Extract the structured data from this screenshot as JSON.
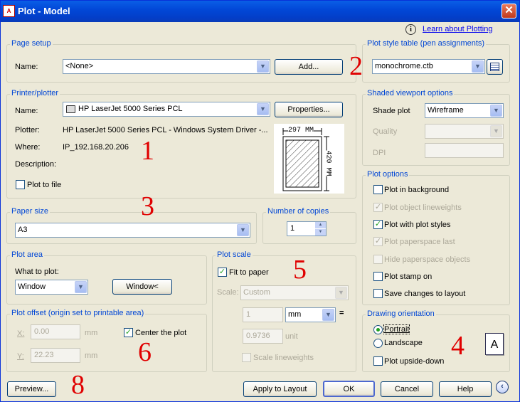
{
  "window": {
    "title": "Plot - Model",
    "close": "✕"
  },
  "help": {
    "icon": "i",
    "link": "Learn about Plotting"
  },
  "page_setup": {
    "title": "Page setup",
    "name_label": "Name:",
    "name_value": "<None>",
    "add_button": "Add..."
  },
  "printer": {
    "title": "Printer/plotter",
    "name_label": "Name:",
    "name_value": "HP LaserJet 5000 Series PCL",
    "properties_button": "Properties...",
    "plotter_label": "Plotter:",
    "plotter_value": "HP LaserJet 5000 Series PCL - Windows System Driver -...",
    "where_label": "Where:",
    "where_value": "IP_192.168.20.206",
    "description_label": "Description:",
    "plot_to_file": "Plot to file",
    "plot_to_file_checked": false,
    "preview_width": "297 MM",
    "preview_height": "420 MM"
  },
  "paper_size": {
    "title": "Paper size",
    "value": "A3"
  },
  "copies": {
    "title": "Number of copies",
    "value": "1"
  },
  "plot_area": {
    "title": "Plot area",
    "what_label": "What to plot:",
    "what_value": "Window",
    "window_button": "Window<"
  },
  "plot_offset": {
    "title": "Plot offset (origin set to printable area)",
    "x_label": "X:",
    "x_value": "0.00",
    "x_unit": "mm",
    "y_label": "Y:",
    "y_value": "22.23",
    "y_unit": "mm",
    "center_label": "Center the plot",
    "center_checked": true
  },
  "plot_scale": {
    "title": "Plot scale",
    "fit_label": "Fit to paper",
    "fit_checked": true,
    "scale_label": "Scale:",
    "scale_value": "Custom",
    "val1": "1",
    "unit1": "mm",
    "equals": "=",
    "val2": "0.9736",
    "unit2": "unit",
    "scale_lw": "Scale lineweights"
  },
  "plot_style": {
    "title": "Plot style table (pen assignments)",
    "value": "monochrome.ctb"
  },
  "shaded": {
    "title": "Shaded viewport options",
    "shade_label": "Shade plot",
    "shade_value": "Wireframe",
    "quality_label": "Quality",
    "dpi_label": "DPI"
  },
  "plot_options": {
    "title": "Plot options",
    "items": [
      {
        "label": "Plot in background",
        "checked": false,
        "disabled": false
      },
      {
        "label": "Plot object lineweights",
        "checked": true,
        "disabled": true
      },
      {
        "label": "Plot with plot styles",
        "checked": true,
        "disabled": false
      },
      {
        "label": "Plot paperspace last",
        "checked": true,
        "disabled": true
      },
      {
        "label": "Hide paperspace objects",
        "checked": false,
        "disabled": true
      },
      {
        "label": "Plot stamp on",
        "checked": false,
        "disabled": false
      },
      {
        "label": "Save changes to layout",
        "checked": false,
        "disabled": false
      }
    ]
  },
  "orientation": {
    "title": "Drawing orientation",
    "portrait": "Portrait",
    "landscape": "Landscape",
    "upside_down": "Plot upside-down",
    "selected": "Portrait",
    "paper_letter": "A"
  },
  "footer": {
    "preview": "Preview...",
    "apply": "Apply to Layout",
    "ok": "OK",
    "cancel": "Cancel",
    "help": "Help",
    "more": "‹"
  },
  "annotations": [
    "1",
    "2",
    "3",
    "4",
    "5",
    "6",
    "8"
  ],
  "colors": {
    "accent": "#0046d5",
    "annotation": "#e00000",
    "titlebar": "#0248d8"
  }
}
